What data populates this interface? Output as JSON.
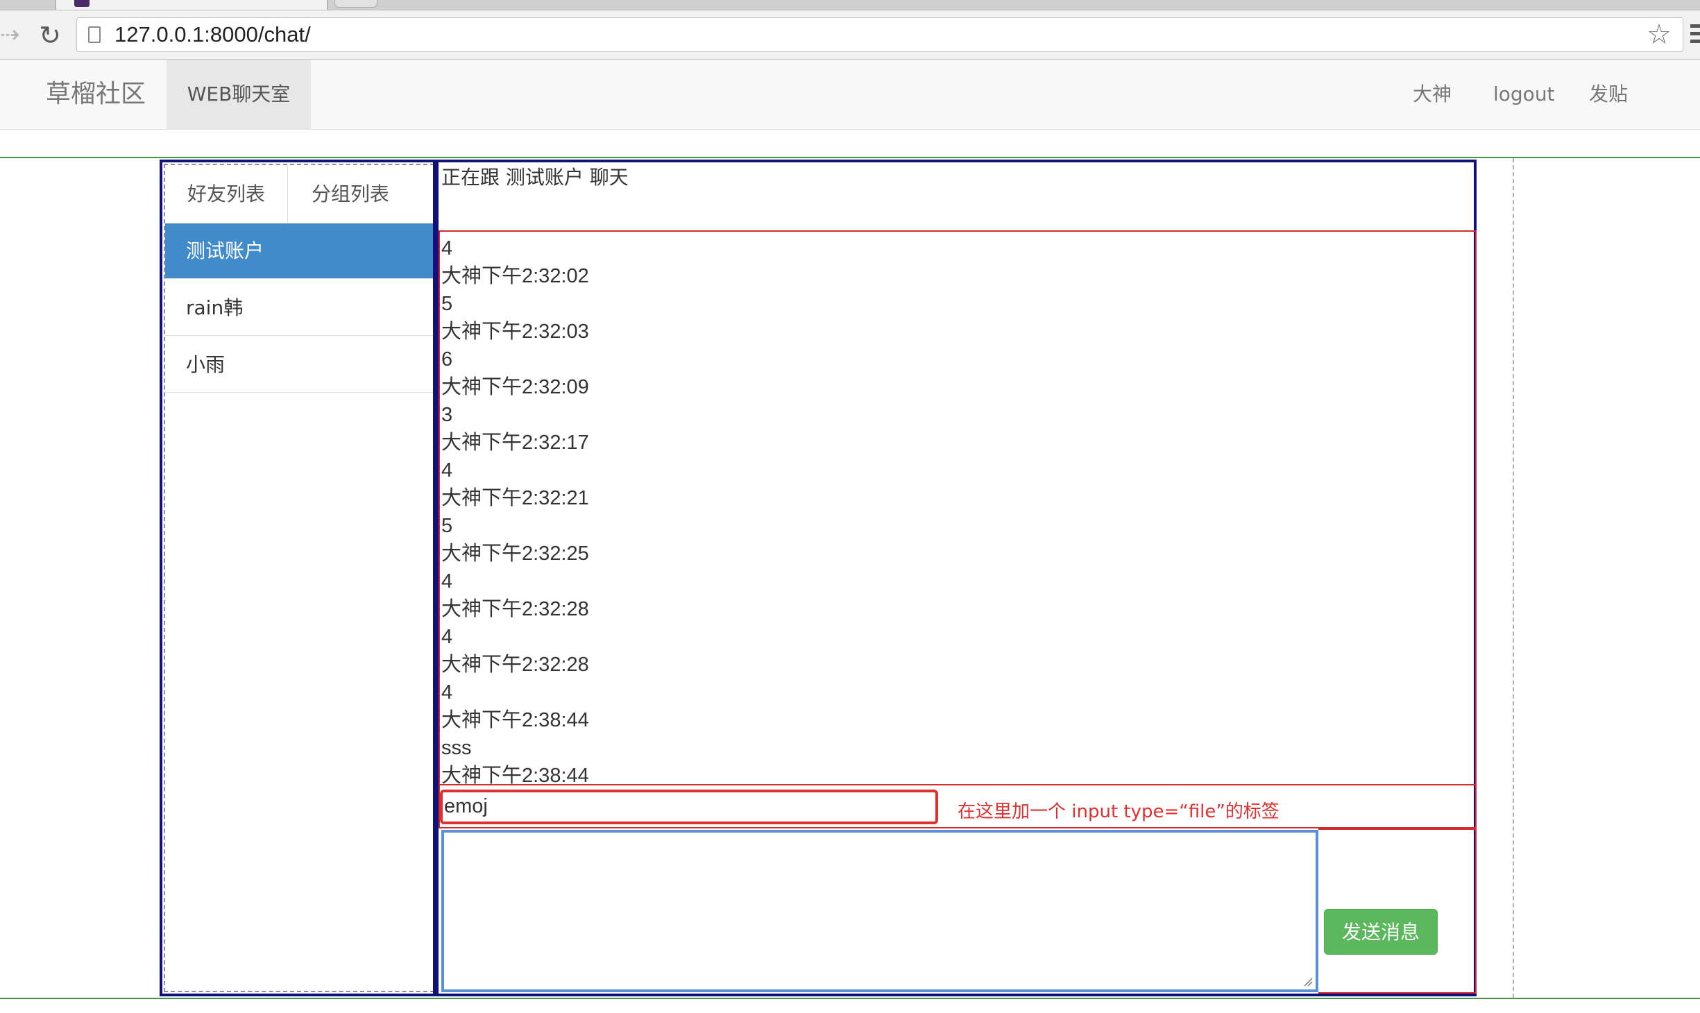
{
  "browser": {
    "url": "127.0.0.1:8000/chat/",
    "icons": [
      "forward-icon",
      "reload-icon",
      "page-icon",
      "star-icon",
      "menu-icon"
    ]
  },
  "navbar": {
    "brand": "草榴社区",
    "active_item": "WEB聊天室",
    "right_items": [
      "大神",
      "logout",
      "发贴"
    ]
  },
  "sidebar": {
    "tabs": [
      "好友列表",
      "分组列表"
    ],
    "friends": [
      "测试账户",
      "rain韩",
      "小雨"
    ],
    "active_friend_index": 0
  },
  "chat": {
    "header": "正在跟 测试账户 聊天",
    "messages": [
      "4",
      "大神下午2:32:02",
      "5",
      "大神下午2:32:03",
      "6",
      "大神下午2:32:09",
      "3",
      "大神下午2:32:17",
      "4",
      "大神下午2:32:21",
      "5",
      "大神下午2:32:25",
      "4",
      "大神下午2:32:28",
      "4",
      "大神下午2:32:28",
      "4",
      "大神下午2:38:44",
      "sss",
      "大神下午2:38:44"
    ],
    "emoji_label": "emoj",
    "annotation": "在这里加一个 input type=“file”的标签",
    "message_input_value": "",
    "send_label": "发送消息"
  },
  "colors": {
    "primary": "#428bca",
    "success": "#5cb85c",
    "frame": "#10127a",
    "annotation_red": "#e23030",
    "layout_green": "#3c9a3c"
  }
}
